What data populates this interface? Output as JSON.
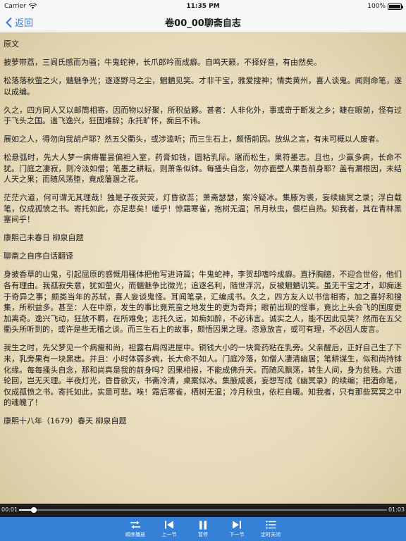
{
  "status": {
    "carrier": "Carrier",
    "time": "11:35 PM",
    "battery": "100%",
    "battery_level": 1.0
  },
  "nav": {
    "back_label": "返回",
    "title": "卷00_00聊斋自志"
  },
  "paragraphs": [
    "原文",
    "披萝带荔，三闾氏感而为骚；牛鬼蛇神，长爪郎吟而成癖。自鸣天籁，不择好音，有由然矣。",
    "松落落秋萤之火，魑魅争光；逐逐野马之尘，魍魉见笑。才非干宝，雅爱搜神；情类黄州，喜人谈鬼。闻则命笔，遂以成编。",
    "久之，四方同人又以邮筒相寄，因而物以好聚，所积益夥。甚者：人非化外，事或奇于断发之乡；睫在眼前，怪有过于飞头之国。遄飞逸兴，狂固难辞；永托旷怀，痴且不讳。",
    "展如之人，得勿向我胡卢耶？然五父衢头，或涉滥听；而三生石上，颇悟前因。放纵之言，有未可概以人废者。",
    "松悬弧时，先大人梦一病瘠瞿昙偏袒入室，药膏如钱，圆粘乳际。寤而松生，果符墨志。且也，少羸多病，长命不犹。门庭之凄寂，则冷淡如僧；笔墨之耕耘，则萧条似钵。每搔头自念，勿亦面壁人果吾前身耶？盖有漏根因，未结人天之果；而随风荡堕，竟成藩溷之花。",
    "茫茫六道，何可谓无其理哉！独是子夜荧荧，灯昏欲蕊；萧斋瑟瑟，案冷疑冰。集腋为裘，妄续幽冥之录；浮白载笔，仅成孤愤之书。寄托如此，亦足悲矣！嗟乎！惊霜寒雀，抱树无温；吊月秋虫，偎栏自热。知我者，其在青林黑塞间乎！",
    "康熙己未春日 柳泉自题",
    "聊斋之自序白话翻译",
    "身披香草的山鬼，引起屈原的感慨用骚体把他写进诗篇；牛鬼蛇神，李贺却嗜吟成癖。直抒胸臆，不迎合世俗，他们各有理由。我孤寂失意，犹如萤火，而魑魅争比微光；追逐名利，随世浮沉，反被魍魉讥笑。虽无干宝之才，却痴迷于奇异之事；颇类当年的苏轼，喜人妄谈鬼怪。耳闻笔录，汇编成书。久之，四方友人以书信相寄，加之喜好和搜集，所积益多。甚至：人在中原，发生的事比竟荒蛮之地发生的更为奇异；眼前出现的怪事，竟比上头会飞的国度更加离奇。逸兴飞动，狂放不羁，在所难免；志托久远，如痴如醉，不必讳言。诚实之人，能不因此见笑？然而在五父衢头所听到的，或许是些无稽之谈。而三生石上的故事，颇悟因果之理。恣意放言，或可有理，不必因人废言。",
    "我生之时，先父梦见一个病瘦和尚，袒露右肩闯进屋中。铜钱大小的一块膏药粘在乳旁。父亲醒后，正好自己生了下来，乳旁果有一块黑痣。并且：小时体弱多病，长大命不如人。门庭冷落，如僧人凄清幽居；笔耕谋生，似和尚持钵化缘。每每搔头自念，那和尚真是我的前身吗？因果相报，不能成佛升天。而随风飘荡，转生人间，身为贫贱。六道轮回，岂无天理。半夜灯光，昏昏欲灭，书斋冷清，桌案似冰。集腋成裘，妄想写成《幽冥录》的续编；把酒命笔，仅成孤愤之书。寄托如此，实是可悲。唉！霜后寒雀，栖树无温；冷月秋虫，依栏自暖。知我者，只有那些冥冥之中的魂魄了！",
    "康熙十八年（1679）春天 柳泉自题"
  ],
  "player": {
    "current_time": "00:01",
    "total_time": "01:03",
    "progress": 0.04
  },
  "toolbar": [
    {
      "label": "顺序播放",
      "icon": "sequential-play-icon"
    },
    {
      "label": "上一节",
      "icon": "previous-icon"
    },
    {
      "label": "暂停",
      "icon": "pause-icon"
    },
    {
      "label": "下一节",
      "icon": "next-icon"
    },
    {
      "label": "定时关闭",
      "icon": "timer-list-icon"
    }
  ]
}
